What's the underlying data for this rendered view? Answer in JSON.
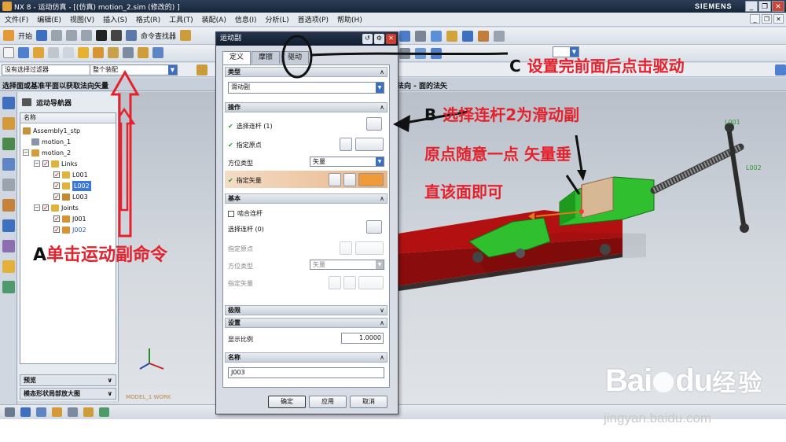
{
  "window": {
    "title": "NX 8 - 运动仿真 - [(仿真) motion_2.sim  (修改的) ]",
    "brand": "SIEMENS",
    "controls": [
      "_",
      "❐",
      "✕"
    ]
  },
  "menu": {
    "items": [
      "文件(F)",
      "编辑(E)",
      "视图(V)",
      "插入(S)",
      "格式(R)",
      "工具(T)",
      "装配(A)",
      "信息(I)",
      "分析(L)",
      "首选项(P)",
      "帮助(H)"
    ],
    "mini_controls": [
      "_",
      "❐",
      "✕"
    ]
  },
  "toolbar1": {
    "start_label": "开始",
    "command_finder": "命令查找器"
  },
  "selection_bar": {
    "filter_value": "没有选择过滤器",
    "scope_value": "整个装配"
  },
  "status": {
    "prompt": "选择面或基准平面以获取法向矢量",
    "prompt_right": "法向 - 面的法矢"
  },
  "navigator": {
    "title": "运动导航器",
    "column": "名称",
    "tree": [
      {
        "label": "Assembly1_stp"
      },
      {
        "label": "motion_1"
      },
      {
        "label": "motion_2"
      },
      {
        "label": "Links"
      },
      {
        "label": "L001"
      },
      {
        "label": "L002"
      },
      {
        "label": "L003"
      },
      {
        "label": "Joints"
      },
      {
        "label": "J001"
      },
      {
        "label": "J002"
      }
    ],
    "footer": [
      "预览",
      "模态形状局部放大图"
    ]
  },
  "dialog": {
    "title": "运动副",
    "tabs": [
      "定义",
      "摩擦",
      "驱动"
    ],
    "type_section": "类型",
    "type_value": "滑动副",
    "operation_section": "操作",
    "select_link": "选择连杆 (1)",
    "specify_origin": "指定原点",
    "orientation_type": "方位类型",
    "orientation_value": "矢量",
    "specify_vector": "指定矢量",
    "base_section": "基本",
    "mesh_links": "啮合连杆",
    "base_select_link": "选择连杆 (0)",
    "base_specify_origin": "指定原点",
    "base_orientation_type": "方位类型",
    "base_orientation_value": "矢量",
    "base_specify_vector": "指定矢量",
    "limits_section": "极限",
    "settings_section": "设置",
    "display_scale_label": "显示比例",
    "display_scale_value": "1.0000",
    "name_section": "名称",
    "name_value": "J003",
    "ok": "确定",
    "apply": "应用",
    "cancel": "取消"
  },
  "annotations": {
    "a_letter": "A",
    "a_text": "单击运动副命令",
    "b_letter": "B",
    "b_line1": "选择连杆2为滑动副",
    "b_line2": "原点随意一点 矢量垂",
    "b_line3": "直该面即可",
    "c_letter": "C",
    "c_text": "设置完前面后点击驱动"
  },
  "viewport": {
    "label_l001": "L001",
    "label_l002": "L002",
    "label_work": "MODEL_1 WORK"
  },
  "watermark": {
    "brand": "Bai",
    "brand2": "du",
    "brand_cn": "经验",
    "url": "jingyan.baidu.com"
  },
  "colors": {
    "annotation_red": "#e4222d",
    "vise_green": "#2fbf2f",
    "base_red": "#c41414",
    "highlight_orange": "#eab688"
  }
}
